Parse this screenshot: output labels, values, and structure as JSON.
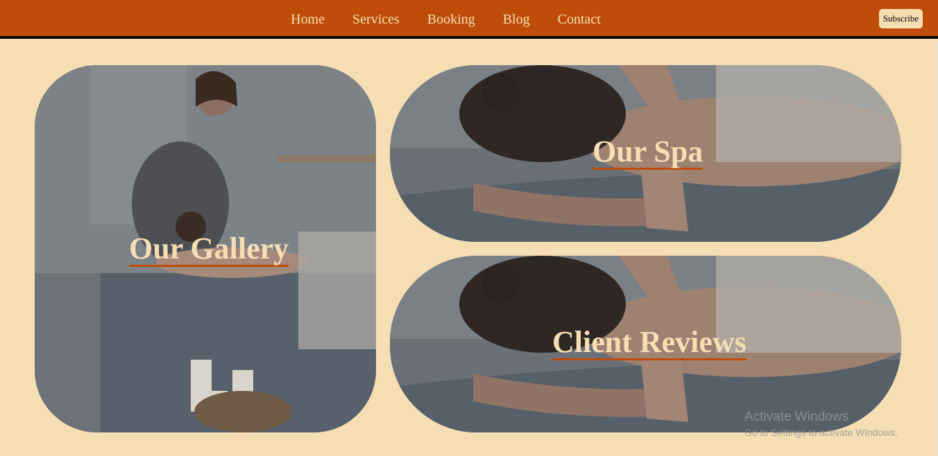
{
  "nav": {
    "links": [
      {
        "label": "Home"
      },
      {
        "label": "Services"
      },
      {
        "label": "Booking"
      },
      {
        "label": "Blog"
      },
      {
        "label": "Contact"
      }
    ],
    "subscribe_label": "Subscribe"
  },
  "cards": {
    "gallery": {
      "title": "Our Gallery"
    },
    "spa": {
      "title": "Our Spa"
    },
    "reviews": {
      "title": "Client Reviews"
    }
  },
  "watermark": {
    "title": "Activate Windows",
    "subtitle": "Go to Settings to activate Windows."
  },
  "colors": {
    "nav_background": "#bf4d09",
    "page_background": "#f5deb3",
    "title_text": "#f5deb3",
    "title_underline": "#bf4d09"
  }
}
